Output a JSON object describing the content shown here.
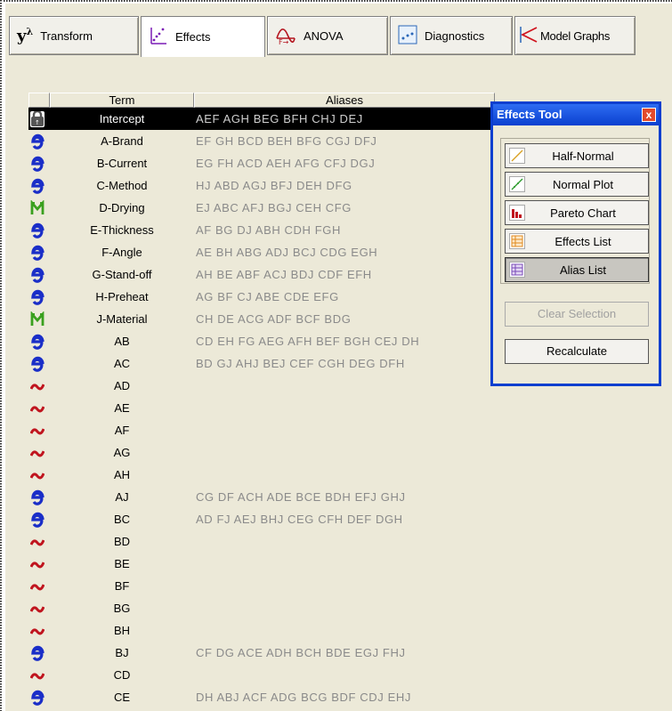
{
  "toolbar": {
    "buttons": [
      {
        "label": "Transform"
      },
      {
        "label": "Effects"
      },
      {
        "label": "ANOVA"
      },
      {
        "label": "Diagnostics"
      },
      {
        "label": "Model Graphs"
      }
    ],
    "transform_icon_text": "y",
    "transform_icon_sup": "λ"
  },
  "table": {
    "col_term": "Term",
    "col_aliases": "Aliases",
    "rows": [
      {
        "kind": "lock",
        "term": "Intercept",
        "aliases": "AEF  AGH  BEG  BFH  CHJ  DEJ"
      },
      {
        "kind": "e",
        "term": "A-Brand",
        "aliases": "EF  GH  BCD  BEH  BFG  CGJ  DFJ"
      },
      {
        "kind": "e",
        "term": "B-Current",
        "aliases": "EG  FH  ACD  AEH  AFG  CFJ  DGJ"
      },
      {
        "kind": "e",
        "term": "C-Method",
        "aliases": "HJ  ABD  AGJ  BFJ  DEH  DFG"
      },
      {
        "kind": "m",
        "term": "D-Drying",
        "aliases": "EJ  ABC  AFJ  BGJ  CEH  CFG"
      },
      {
        "kind": "e",
        "term": "E-Thickness",
        "aliases": "AF  BG  DJ  ABH  CDH  FGH"
      },
      {
        "kind": "e",
        "term": "F-Angle",
        "aliases": "AE  BH  ABG  ADJ  BCJ  CDG  EGH"
      },
      {
        "kind": "e",
        "term": "G-Stand-off",
        "aliases": "AH  BE  ABF  ACJ  BDJ  CDF  EFH"
      },
      {
        "kind": "e",
        "term": "H-Preheat",
        "aliases": "AG  BF  CJ  ABE  CDE  EFG"
      },
      {
        "kind": "m",
        "term": "J-Material",
        "aliases": "CH  DE  ACG  ADF  BCF  BDG"
      },
      {
        "kind": "e",
        "term": "AB",
        "aliases": "CD  EH  FG  AEG  AFH  BEF  BGH  CEJ  DH"
      },
      {
        "kind": "e",
        "term": "AC",
        "aliases": "BD  GJ  AHJ  BEJ  CEF  CGH  DEG  DFH"
      },
      {
        "kind": "w",
        "term": "AD",
        "aliases": ""
      },
      {
        "kind": "w",
        "term": "AE",
        "aliases": ""
      },
      {
        "kind": "w",
        "term": "AF",
        "aliases": ""
      },
      {
        "kind": "w",
        "term": "AG",
        "aliases": ""
      },
      {
        "kind": "w",
        "term": "AH",
        "aliases": ""
      },
      {
        "kind": "e",
        "term": "AJ",
        "aliases": "CG  DF  ACH  ADE  BCE  BDH  EFJ  GHJ"
      },
      {
        "kind": "e",
        "term": "BC",
        "aliases": "AD  FJ  AEJ  BHJ  CEG  CFH  DEF  DGH"
      },
      {
        "kind": "w",
        "term": "BD",
        "aliases": ""
      },
      {
        "kind": "w",
        "term": "BE",
        "aliases": ""
      },
      {
        "kind": "w",
        "term": "BF",
        "aliases": ""
      },
      {
        "kind": "w",
        "term": "BG",
        "aliases": ""
      },
      {
        "kind": "w",
        "term": "BH",
        "aliases": ""
      },
      {
        "kind": "e",
        "term": "BJ",
        "aliases": "CF  DG  ACE  ADH  BCH  BDE  EGJ  FHJ"
      },
      {
        "kind": "w",
        "term": "CD",
        "aliases": ""
      },
      {
        "kind": "e",
        "term": "CE",
        "aliases": "DH  ABJ  ACF  ADG  BCG  BDF  CDJ  EHJ"
      }
    ]
  },
  "effects_tool": {
    "title": "Effects Tool",
    "close": "x",
    "buttons": [
      {
        "label": "Half-Normal"
      },
      {
        "label": "Normal Plot"
      },
      {
        "label": "Pareto Chart"
      },
      {
        "label": "Effects List"
      },
      {
        "label": "Alias List"
      }
    ],
    "clear_selection": "Clear Selection",
    "recalculate": "Recalculate"
  },
  "colors": {
    "e_icon": "#1a2ec8",
    "m_icon": "#3aa01e",
    "w_icon": "#c0141e",
    "title_bar": "#0a3fcf"
  }
}
